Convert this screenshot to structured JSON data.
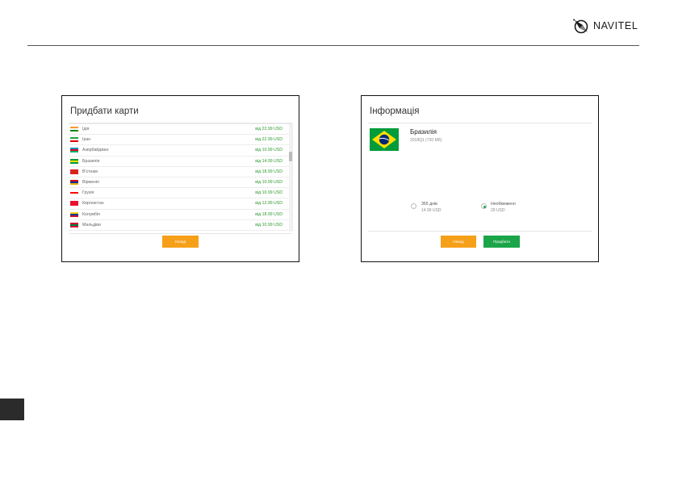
{
  "brand": {
    "logo_text": "NAVITEL",
    "icon": "navitel-compass-icon"
  },
  "left_panel": {
    "title": "Придбати карти",
    "maps": [
      {
        "name": "Ідія",
        "price": "від 22.99 USD",
        "flag": [
          "#ff9933",
          "#ffffff",
          "#138808"
        ]
      },
      {
        "name": "Іран",
        "price": "від 22.99 USD",
        "flag": [
          "#239f40",
          "#ffffff",
          "#da0000"
        ]
      },
      {
        "name": "Азербайджан",
        "price": "від 10.99 USD",
        "flag": [
          "#0092bc",
          "#e4002b",
          "#00af66"
        ]
      },
      {
        "name": "Бразилія",
        "price": "від 14.99 USD",
        "flag": [
          "#009b3a",
          "#fedf00",
          "#009b3a"
        ]
      },
      {
        "name": "В'єтнам",
        "price": "від 18.99 USD",
        "flag": [
          "#da251d",
          "#da251d",
          "#da251d"
        ]
      },
      {
        "name": "Вірменія",
        "price": "від 10.99 USD",
        "flag": [
          "#d90012",
          "#0033a0",
          "#f2a800"
        ]
      },
      {
        "name": "Грузія",
        "price": "від 10.99 USD",
        "flag": [
          "#ffffff",
          "#ff0000",
          "#ffffff"
        ]
      },
      {
        "name": "Киргизстан",
        "price": "від 12.99 USD",
        "flag": [
          "#e8112d",
          "#e8112d",
          "#e8112d"
        ]
      },
      {
        "name": "Колумбія",
        "price": "від 18.99 USD",
        "flag": [
          "#fcd116",
          "#003893",
          "#ce1126"
        ]
      },
      {
        "name": "Мальдіви",
        "price": "від 10.99 USD",
        "flag": [
          "#d21034",
          "#007e3a",
          "#d21034"
        ]
      }
    ],
    "back_label": "Назад"
  },
  "right_panel": {
    "title": "Інформація",
    "country": "Бразилія",
    "version": "2018Q1 (720 Мб)",
    "options": [
      {
        "label": "365 днів",
        "price": "14.99 USD",
        "selected": false
      },
      {
        "label": "Необмежено",
        "price": "29 USD",
        "selected": true
      }
    ],
    "back_label": "Назад",
    "buy_label": "Придбати"
  },
  "colors": {
    "accent_orange": "#f6a01a",
    "accent_green": "#1aa548",
    "price_green": "#2d9a2d"
  }
}
